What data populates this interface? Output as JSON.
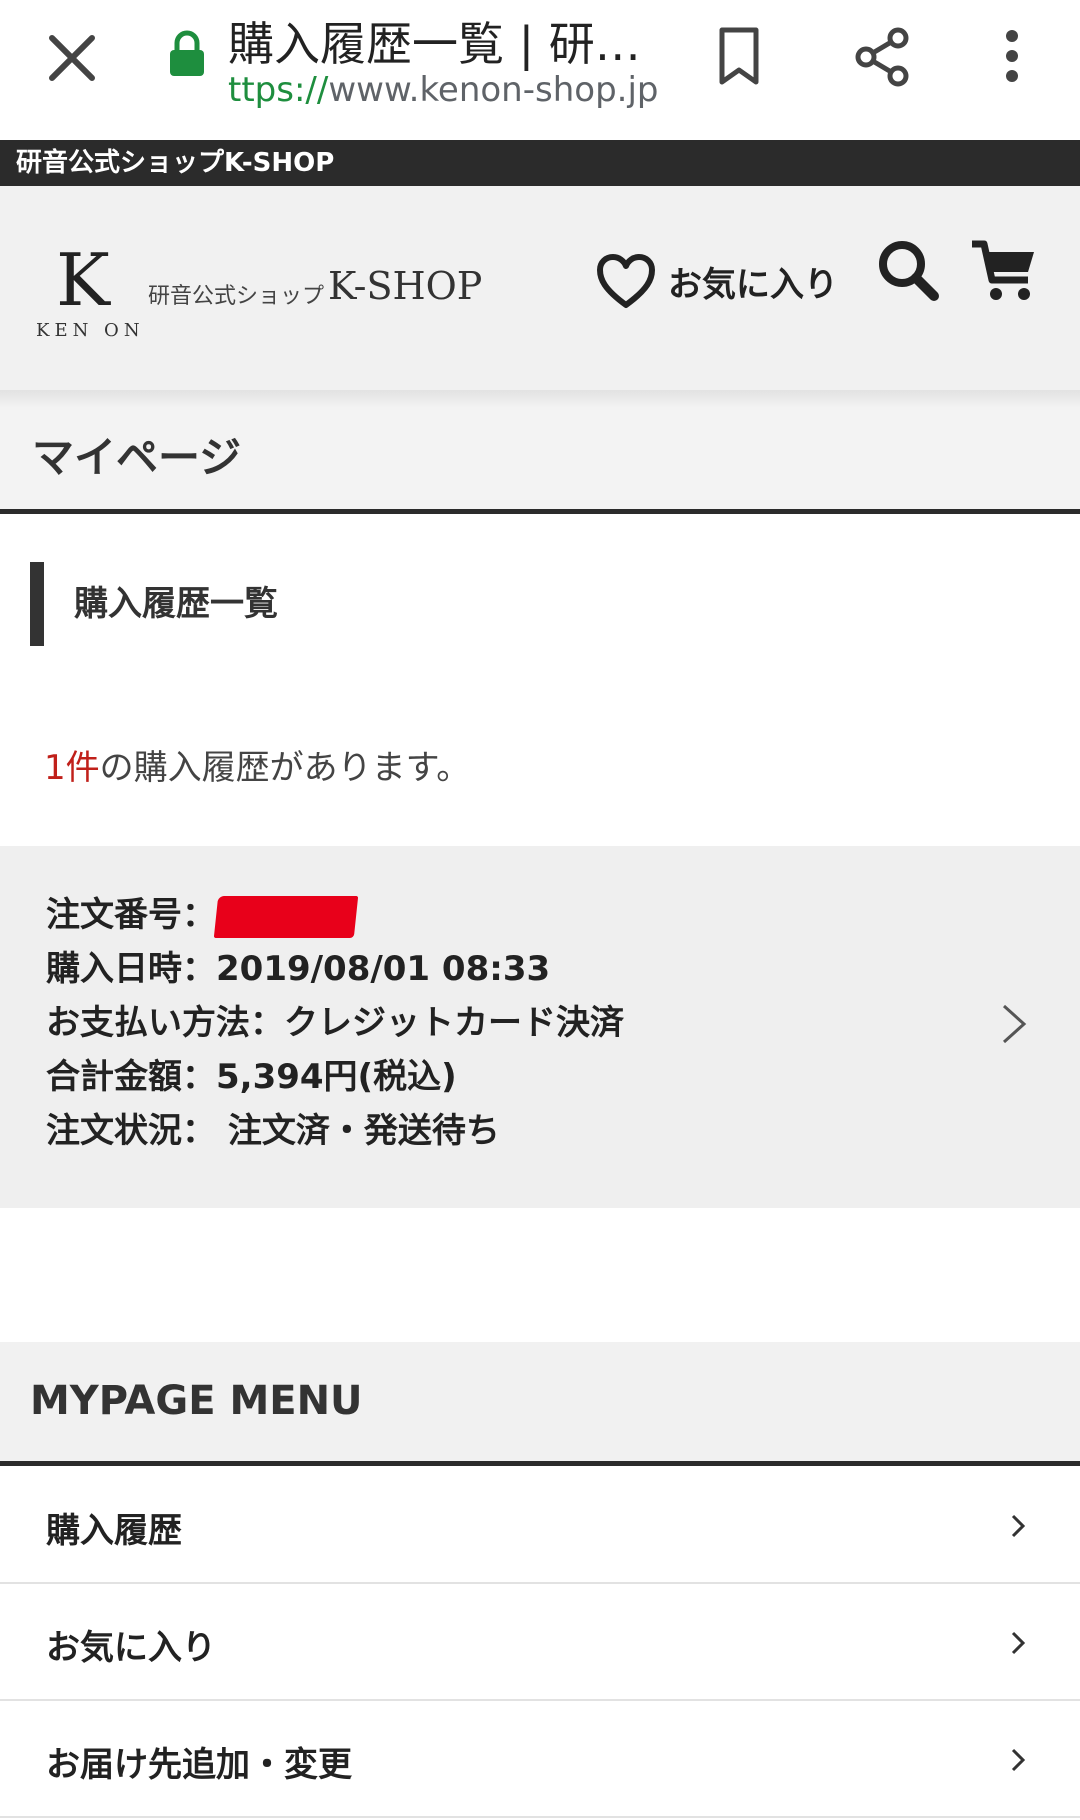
{
  "browser": {
    "tab_title": "購入履歴一覧 | 研…",
    "url_scheme": "ttps://",
    "url_host": "www.kenon-shop.jp"
  },
  "site_strip": {
    "label": "研音公式ショップK-SHOP"
  },
  "header": {
    "logo_k": "K",
    "logo_kenon": "KEN ON",
    "logo_shop_jp": "研音公式ショップ",
    "logo_shop_en": "K-SHOP",
    "favorites_label": "お気に入り"
  },
  "page_title": "マイページ",
  "section_heading": "購入履歴一覧",
  "history_count": {
    "number": "1件",
    "suffix": "の購入履歴があります。"
  },
  "order": {
    "number_label": "注文番号：",
    "date_line": "購入日時：2019/08/01 08:33",
    "payment_line": "お支払い方法：クレジットカード決済",
    "total_line": "合計金額：5,394円(税込)",
    "status_line": "注文状況： 注文済・発送待ち"
  },
  "menu": {
    "heading": "MYPAGE MENU",
    "items": [
      {
        "label": "購入履歴"
      },
      {
        "label": "お気に入り"
      },
      {
        "label": "お届け先追加・変更"
      }
    ]
  },
  "colors": {
    "accent_red": "#c0201a",
    "lock_green": "#1e8e3e",
    "dark_bar": "#2b2b2b"
  },
  "icons": [
    "close-icon",
    "lock-icon",
    "bookmark-icon",
    "share-icon",
    "more-vert-icon",
    "heart-icon",
    "search-icon",
    "cart-icon",
    "chevron-right-icon"
  ]
}
